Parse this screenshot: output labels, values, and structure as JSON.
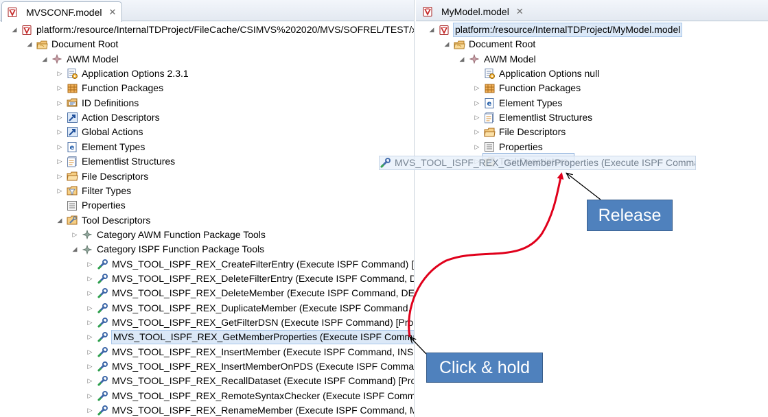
{
  "left_pane": {
    "tab_title": "MVSCONF.model",
    "tree": [
      {
        "label": "platform:/resource/InternalTDProject/FileCache/CSIMVS%202020/MVS/SOFREL/TEST/x",
        "icon": "model-file-icon",
        "twisty": "expanded"
      },
      {
        "label": "Document Root",
        "icon": "document-root-icon",
        "twisty": "expanded"
      },
      {
        "label": "AWM Model",
        "icon": "model-diamond-icon",
        "twisty": "expanded"
      },
      {
        "label": "Application Options 2.3.1",
        "icon": "application-options-icon",
        "twisty": "collapsed"
      },
      {
        "label": "Function Packages",
        "icon": "function-packages-icon",
        "twisty": "collapsed"
      },
      {
        "label": "ID Definitions",
        "icon": "id-definitions-icon",
        "twisty": "collapsed"
      },
      {
        "label": "Action Descriptors",
        "icon": "action-descriptors-icon",
        "twisty": "collapsed"
      },
      {
        "label": "Global Actions",
        "icon": "global-actions-icon",
        "twisty": "collapsed"
      },
      {
        "label": "Element Types",
        "icon": "element-types-icon",
        "twisty": "collapsed"
      },
      {
        "label": "Elementlist Structures",
        "icon": "elementlist-structures-icon",
        "twisty": "collapsed"
      },
      {
        "label": "File Descriptors",
        "icon": "file-descriptors-icon",
        "twisty": "collapsed"
      },
      {
        "label": "Filter Types",
        "icon": "filter-types-icon",
        "twisty": "collapsed"
      },
      {
        "label": "Properties",
        "icon": "properties-icon",
        "twisty": "none"
      },
      {
        "label": "Tool Descriptors",
        "icon": "tool-descriptors-icon",
        "twisty": "expanded"
      },
      {
        "label": "Category AWM Function Package Tools",
        "icon": "category-icon",
        "twisty": "collapsed"
      },
      {
        "label": "Category ISPF Function Package Tools",
        "icon": "category-icon",
        "twisty": "expanded"
      },
      {
        "label": "MVS_TOOL_ISPF_REX_CreateFilterEntry (Execute ISPF Command) [Pro",
        "icon": "tool-icon",
        "twisty": "collapsed"
      },
      {
        "label": "MVS_TOOL_ISPF_REX_DeleteFilterEntry (Execute ISPF Command, DELE",
        "icon": "tool-icon",
        "twisty": "collapsed"
      },
      {
        "label": "MVS_TOOL_ISPF_REX_DeleteMember (Execute ISPF Command, DELET",
        "icon": "tool-icon",
        "twisty": "collapsed"
      },
      {
        "label": "MVS_TOOL_ISPF_REX_DuplicateMember (Execute ISPF Command, CC",
        "icon": "tool-icon",
        "twisty": "collapsed"
      },
      {
        "label": "MVS_TOOL_ISPF_REX_GetFilterDSN (Execute ISPF Command) [Progra",
        "icon": "tool-icon",
        "twisty": "collapsed"
      },
      {
        "label": "MVS_TOOL_ISPF_REX_GetMemberProperties (Execute ISPF Command",
        "icon": "tool-icon",
        "twisty": "collapsed",
        "selected": true
      },
      {
        "label": "MVS_TOOL_ISPF_REX_InsertMember (Execute ISPF Command, INSERT",
        "icon": "tool-icon",
        "twisty": "collapsed"
      },
      {
        "label": "MVS_TOOL_ISPF_REX_InsertMemberOnPDS (Execute ISPF Command,",
        "icon": "tool-icon",
        "twisty": "collapsed"
      },
      {
        "label": "MVS_TOOL_ISPF_REX_RecallDataset (Execute ISPF Command) [Progra",
        "icon": "tool-icon",
        "twisty": "collapsed"
      },
      {
        "label": "MVS_TOOL_ISPF_REX_RemoteSyntaxChecker (Execute ISPF Comman",
        "icon": "tool-icon",
        "twisty": "collapsed"
      },
      {
        "label": "MVS_TOOL_ISPF_REX_RenameMember (Execute ISPF Command, MO",
        "icon": "tool-icon",
        "twisty": "collapsed"
      }
    ]
  },
  "right_pane": {
    "tab_title": "MyModel.model",
    "tree": [
      {
        "label": "platform:/resource/InternalTDProject/MyModel.model",
        "icon": "model-file-icon",
        "twisty": "expanded",
        "selected": true
      },
      {
        "label": "Document Root",
        "icon": "document-root-icon",
        "twisty": "expanded"
      },
      {
        "label": "AWM Model",
        "icon": "model-diamond-icon",
        "twisty": "expanded"
      },
      {
        "label": "Application Options null",
        "icon": "application-options-icon",
        "twisty": "none"
      },
      {
        "label": "Function Packages",
        "icon": "function-packages-icon",
        "twisty": "collapsed"
      },
      {
        "label": "Element Types",
        "icon": "element-types-icon",
        "twisty": "collapsed"
      },
      {
        "label": "Elementlist Structures",
        "icon": "elementlist-structures-icon",
        "twisty": "collapsed"
      },
      {
        "label": "File Descriptors",
        "icon": "file-descriptors-icon",
        "twisty": "collapsed"
      },
      {
        "label": "Properties",
        "icon": "properties-icon",
        "twisty": "collapsed"
      },
      {
        "label": "Tool Descriptors",
        "icon": "tool-descriptors-icon",
        "twisty": "collapsed"
      }
    ]
  },
  "drag_ghost": {
    "label": "MVS_TOOL_ISPF_REX_GetMemberProperties (Execute ISPF Command",
    "icon": "tool-icon"
  },
  "annotations": {
    "release": "Release",
    "click_hold": "Click & hold",
    "arrow_color": "#e0001b",
    "callout_color": "#4f81bd"
  }
}
